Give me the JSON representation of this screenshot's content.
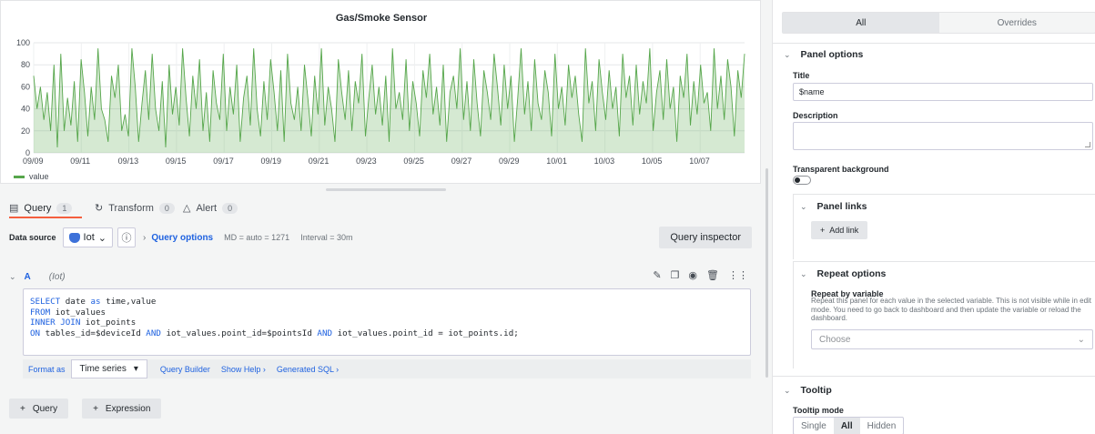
{
  "panel": {
    "title": "Gas/Smoke Sensor"
  },
  "chart_data": {
    "type": "line",
    "title": "Gas/Smoke Sensor",
    "xlabel": "",
    "ylabel": "",
    "x_ticks": [
      "09/09",
      "09/11",
      "09/13",
      "09/15",
      "09/17",
      "09/19",
      "09/21",
      "09/23",
      "09/25",
      "09/27",
      "09/29",
      "10/01",
      "10/03",
      "10/05",
      "10/07"
    ],
    "y_ticks": [
      0,
      20,
      40,
      60,
      80,
      100
    ],
    "ylim": [
      0,
      100
    ],
    "grid": true,
    "legend": "bottom-left",
    "series": [
      {
        "name": "value",
        "color": "#56a64b",
        "fill": "#56a64b33",
        "values": [
          70,
          40,
          60,
          30,
          55,
          20,
          80,
          5,
          90,
          20,
          50,
          25,
          65,
          10,
          85,
          55,
          15,
          60,
          30,
          95,
          40,
          30,
          10,
          70,
          50,
          80,
          20,
          35,
          15,
          95,
          60,
          10,
          45,
          75,
          30,
          90,
          40,
          20,
          65,
          5,
          80,
          35,
          60,
          25,
          95,
          50,
          15,
          70,
          40,
          85,
          20,
          55,
          10,
          75,
          45,
          30,
          90,
          20,
          60,
          35,
          80,
          10,
          50,
          70,
          25,
          95,
          40,
          15,
          65,
          30,
          85,
          55,
          20,
          75,
          10,
          90,
          45,
          30,
          60,
          20,
          80,
          50,
          15,
          70,
          35,
          95,
          25,
          60,
          40,
          10,
          85,
          55,
          30,
          75,
          20,
          65,
          45,
          90,
          15,
          50,
          80,
          35,
          60,
          25,
          70,
          10,
          95,
          40,
          55,
          30,
          85,
          20,
          65,
          45,
          15,
          75,
          50,
          90,
          35,
          60,
          25,
          80,
          10,
          55,
          70,
          40,
          95,
          30,
          65,
          20,
          85,
          45,
          15,
          75,
          55,
          30,
          90,
          60,
          25,
          80,
          40,
          70,
          10,
          50,
          95,
          35,
          65,
          20,
          85,
          45,
          30,
          75,
          55,
          15,
          90,
          40,
          60,
          25,
          80,
          50,
          70,
          35,
          10,
          95,
          45,
          65,
          20,
          85,
          55,
          30,
          75,
          40,
          60,
          15,
          90,
          50,
          70,
          25,
          80,
          35,
          65,
          45,
          95,
          20,
          55,
          75,
          30,
          85,
          40,
          60,
          10,
          70,
          50,
          90,
          25,
          65,
          35,
          80,
          45,
          55,
          20,
          95,
          40,
          70,
          30,
          85,
          60,
          15,
          75,
          50,
          90
        ]
      }
    ]
  },
  "tabs": [
    {
      "label": "Query",
      "count": "1"
    },
    {
      "label": "Transform",
      "count": "0"
    },
    {
      "label": "Alert",
      "count": "0"
    }
  ],
  "query_header": {
    "data_source_label": "Data source",
    "data_source_value": "Iot",
    "query_options_label": "Query options",
    "md": "MD = auto = 1271",
    "interval": "Interval = 30m",
    "inspector": "Query inspector"
  },
  "query": {
    "ref_id": "A",
    "datasource_name": "(Iot)",
    "sql_lines": [
      "SELECT date as time,value",
      "FROM iot_values",
      "INNER JOIN iot_points",
      "ON tables_id=$deviceId AND iot_values.point_id=$pointsId AND iot_values.point_id = iot_points.id;"
    ]
  },
  "query_options_row": {
    "format_as_label": "Format as",
    "format_as_value": "Time series",
    "query_builder": "Query Builder",
    "show_help": "Show Help",
    "generated_sql": "Generated SQL"
  },
  "add": {
    "query": "Query",
    "expression": "Expression"
  },
  "options": {
    "tab_all": "All",
    "tab_overrides": "Overrides",
    "panel_options_title": "Panel options",
    "title_label": "Title",
    "title_value": "$name",
    "description_label": "Description",
    "transparent_label": "Transparent background",
    "panel_links_title": "Panel links",
    "add_link": "Add link",
    "repeat_title": "Repeat options",
    "repeat_by_label": "Repeat by variable",
    "repeat_desc": "Repeat this panel for each value in the selected variable. This is not visible while in edit mode. You need to go back to dashboard and then update the variable or reload the dashboard.",
    "choose": "Choose",
    "tooltip_title": "Tooltip",
    "tooltip_mode_label": "Tooltip mode",
    "tooltip_modes": [
      "Single",
      "All",
      "Hidden"
    ]
  }
}
